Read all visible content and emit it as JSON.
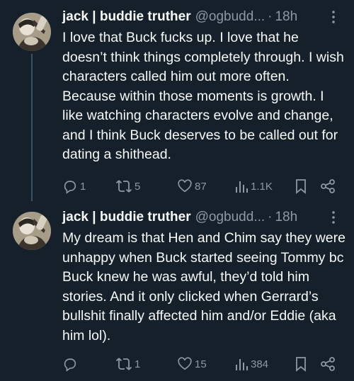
{
  "tweets": [
    {
      "author_name": "jack | buddie truther",
      "handle": "@ogbudd...",
      "separator": "·",
      "time": "18h",
      "text": "I love that Buck fucks up. I love that he doesn’t think things completely through. I wish characters called him out more often. Because within those moments is growth. I like watching characters evolve and change, and I think Buck deserves to be called out for dating a shithead.",
      "replies": "1",
      "retweets": "5",
      "likes": "87",
      "views": "1.1K"
    },
    {
      "author_name": "jack | buddie truther",
      "handle": "@ogbudd...",
      "separator": "·",
      "time": "18h",
      "text": "My dream is that Hen and Chim say they were unhappy when Buck started seeing Tommy bc Buck knew he was awful, they’d told him stories. And it only clicked when Gerrard’s bullshit finally affected him and/or Eddie (aka him lol).",
      "replies": "",
      "retweets": "1",
      "likes": "15",
      "views": "384"
    }
  ],
  "icons": {
    "reply": "reply-icon",
    "retweet": "retweet-icon",
    "like": "heart-icon",
    "views": "views-icon",
    "bookmark": "bookmark-icon",
    "share": "share-icon",
    "more": "more-icon"
  },
  "colors": {
    "background": "#15202b",
    "text": "#f7f9f9",
    "muted": "#8b98a5",
    "thread_line": "#3d5466"
  }
}
